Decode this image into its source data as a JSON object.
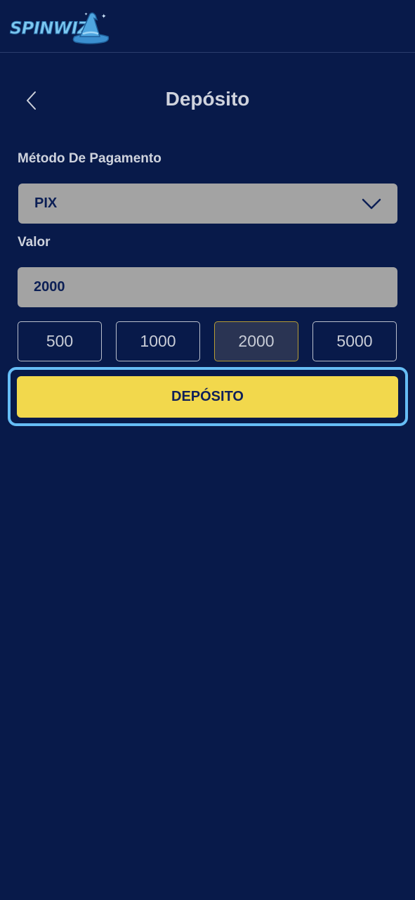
{
  "brand": {
    "name": "SPINWIZ",
    "logo_icon": "wizard-hat-icon"
  },
  "header": {
    "title": "Depósito",
    "back_icon": "chevron-left-icon"
  },
  "form": {
    "method_label": "Método De Pagamento",
    "method_value": "PIX",
    "method_dropdown_icon": "chevron-down-icon",
    "value_label": "Valor",
    "value_input": "2000",
    "quick_amounts": [
      "500",
      "1000",
      "2000",
      "5000"
    ],
    "selected_amount": "2000",
    "submit_label": "DEPÓSITO"
  },
  "colors": {
    "background": "#081a4a",
    "accent_yellow": "#f2d84c",
    "focus_ring": "#66bdf5",
    "field_gray": "#a3a3a3"
  }
}
